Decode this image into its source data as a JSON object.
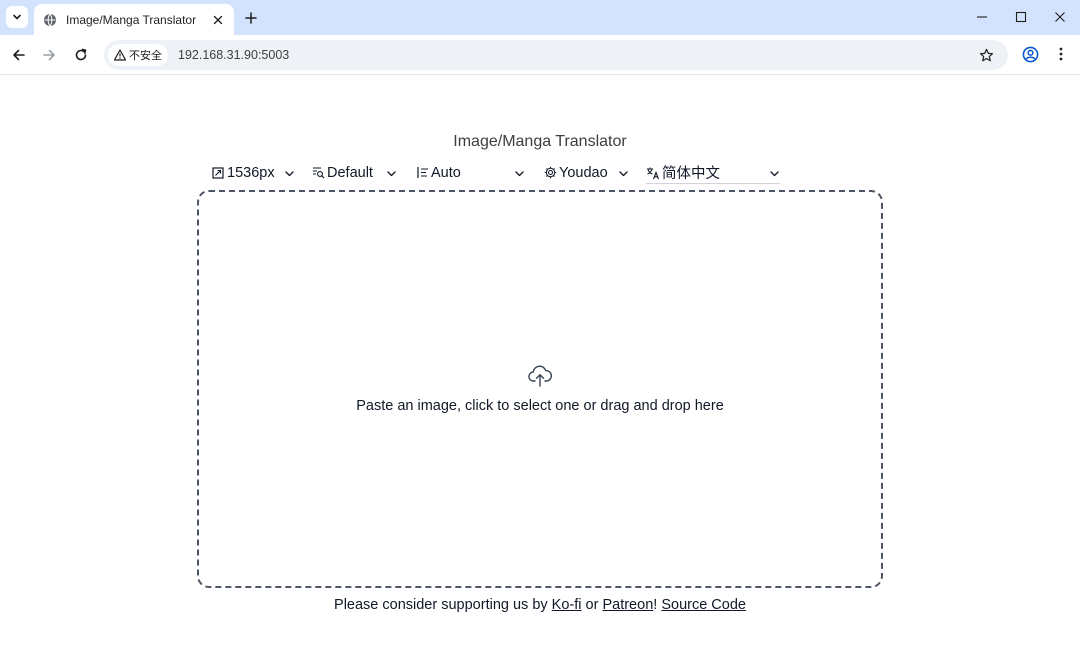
{
  "browser": {
    "tab_title": "Image/Manga Translator",
    "security_label": "不安全",
    "url": "192.168.31.90:5003"
  },
  "page": {
    "title": "Image/Manga Translator",
    "controls": {
      "size": "1536px",
      "detector": "Default",
      "direction": "Auto",
      "translator": "Youdao",
      "target_language": "简体中文"
    },
    "dropzone_text": "Paste an image, click to select one or drag and drop here",
    "footer": {
      "prefix": "Please consider supporting us by",
      "kofi": "Ko-fi",
      "or": "or",
      "patreon": "Patreon",
      "exclaim": "!",
      "source_code": "Source Code"
    }
  },
  "icons": {
    "tab_search": "chevron-down-icon",
    "favicon": "globe-icon",
    "close": "close-icon",
    "new_tab": "plus-icon",
    "minimize": "minimize-icon",
    "maximize": "maximize-icon",
    "window_close": "close-icon",
    "back": "arrow-left-icon",
    "forward": "arrow-right-icon",
    "reload": "reload-icon",
    "warning": "warning-icon",
    "bookmark": "star-icon",
    "profile": "profile-icon",
    "menu": "more-vertical-icon",
    "upload": "cloud-upload-icon"
  },
  "colors": {
    "tabbar": "#d3e3fd",
    "omnibox": "#eef1f6",
    "dropzone_border": "#4b5563"
  }
}
